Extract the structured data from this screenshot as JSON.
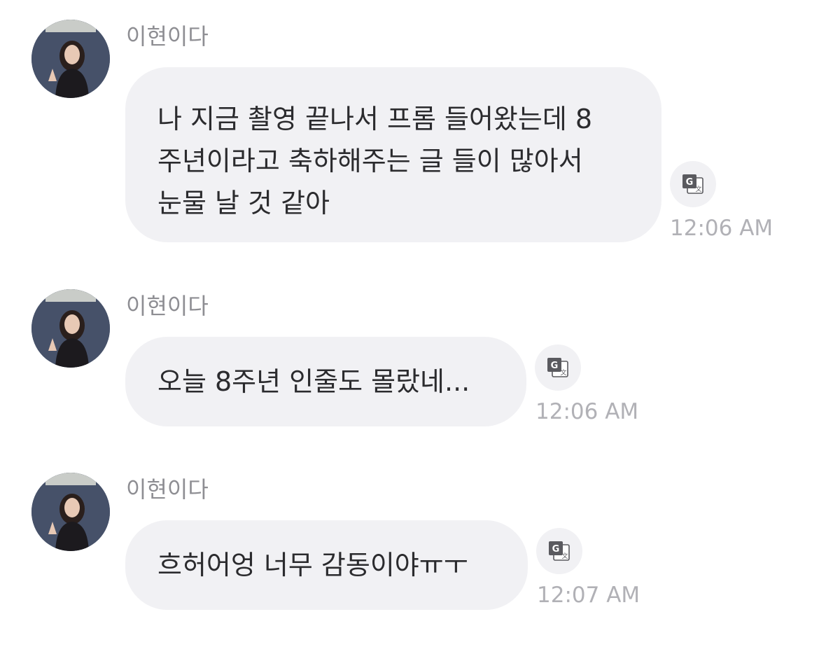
{
  "messages": [
    {
      "sender": "이현이다",
      "lines": [
        "나 지금 촬영 끝나서 프롬 들어왔는데 8",
        "주년이라고 축하해주는 글 들이 많아서",
        "눈물 날 것 같아"
      ],
      "time": "12:06 AM"
    },
    {
      "sender": "이현이다",
      "lines": [
        "오늘 8주년 인줄도 몰랐네..."
      ],
      "time": "12:06 AM"
    },
    {
      "sender": "이현이다",
      "lines": [
        "흐허어엉 너무 감동이야ㅠㅜ"
      ],
      "time": "12:07 AM"
    }
  ],
  "icons": {
    "avatar": "profile-photo",
    "translate": "translate-icon"
  },
  "colors": {
    "bubble": "#f1f1f4",
    "text": "#2b2b2e",
    "sender": "#8e8e93",
    "time": "#b1b1b6"
  }
}
